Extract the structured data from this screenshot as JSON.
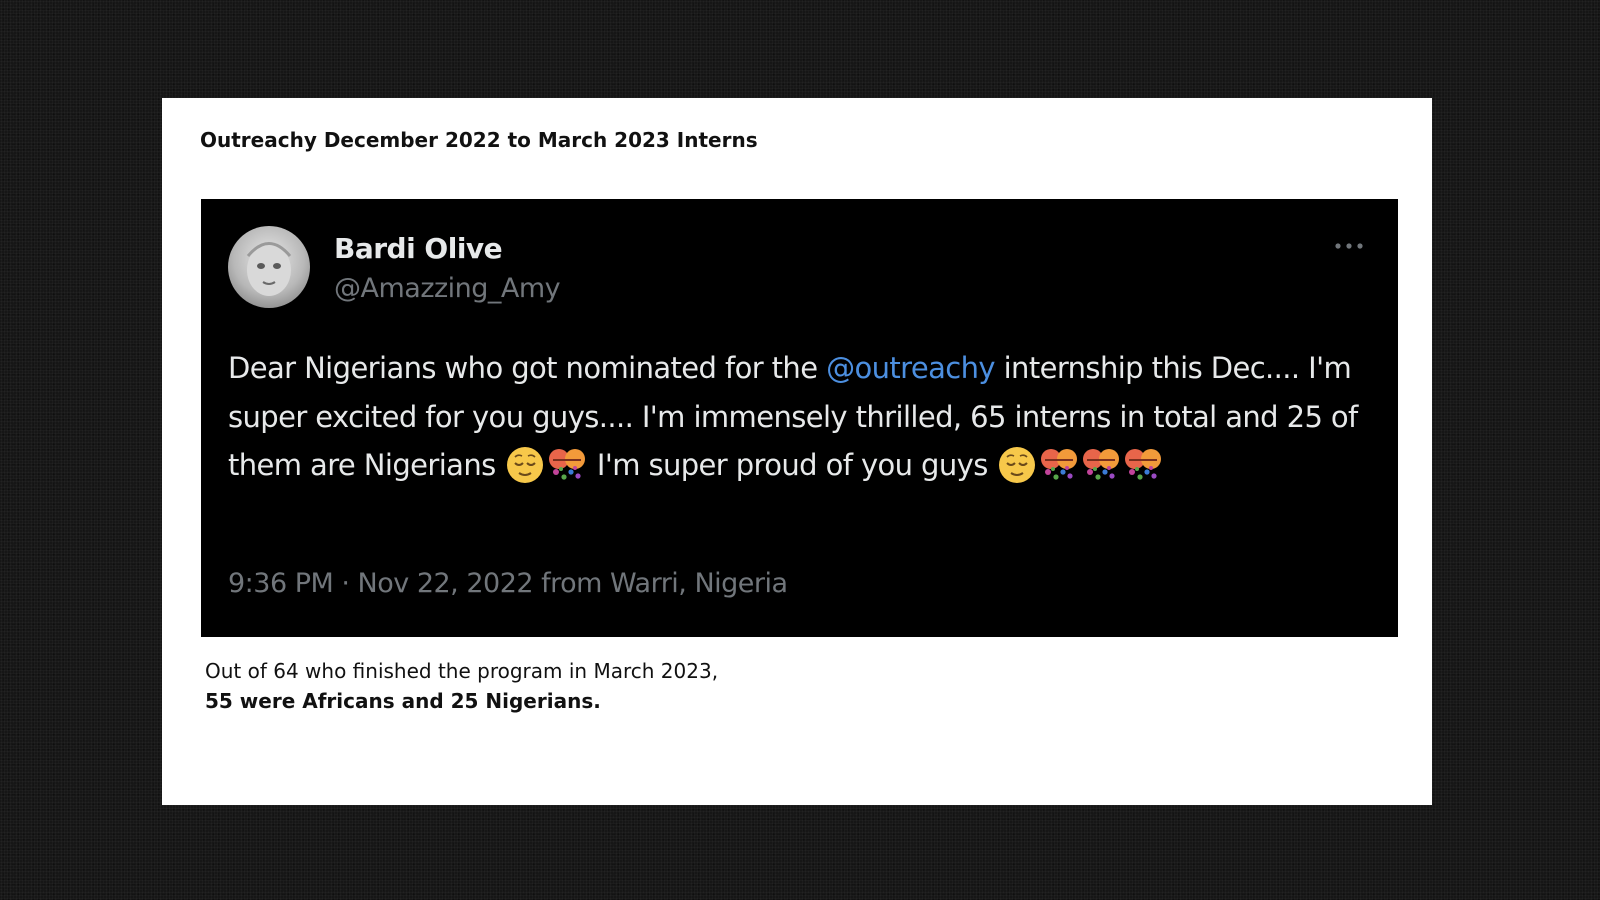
{
  "slide": {
    "title": "Outreachy December 2022 to March 2023 Interns"
  },
  "tweet": {
    "author_name": "Bardi Olive",
    "author_handle": "@Amazzing_Amy",
    "text_part1": "Dear Nigerians who got nominated for the ",
    "mention": "@outreachy",
    "text_part2": " internship this Dec.... I'm super excited for you guys.... I'm immensely thrilled, 65 interns in total and 25 of them are Nigerians ",
    "text_part3": " I'm super proud of you guys ",
    "timestamp": "9:36 PM · Nov 22, 2022 from Warri, Nigeria",
    "icons": {
      "more": "more-options-icon",
      "relieved": "relieved-face-emoji",
      "confetti": "confetti-emoji"
    }
  },
  "caption": {
    "line1": "Out of 64 who finished the program in March 2023,",
    "line2": "55 were Africans and 25 Nigerians."
  },
  "colors": {
    "background": "#161616",
    "slide": "#ffffff",
    "tweet_background": "#000000",
    "tweet_text": "#e7e9ea",
    "secondary_text": "#71767b",
    "mention": "#4c8fe0"
  }
}
